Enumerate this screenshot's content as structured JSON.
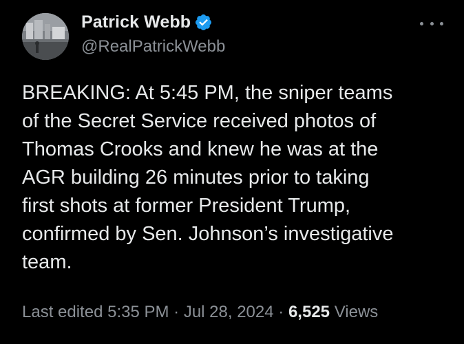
{
  "author": {
    "display_name": "Patrick Webb",
    "handle": "@RealPatrickWebb",
    "verified": true,
    "verified_icon": "verified-badge-icon",
    "verified_color": "#1d9bf0"
  },
  "tweet": {
    "text_lines": [
      "BREAKING: At 5:45 PM, the sniper teams",
      "of the Secret Service received photos of",
      "Thomas Crooks and knew he was at the",
      "AGR building 26 minutes prior to taking",
      "first shots at former President Trump,",
      "confirmed by Sen. Johnson’s investigative",
      "team."
    ],
    "edit_label": "Last edited",
    "time": "5:35 PM",
    "separator": "·",
    "date": "Jul 28, 2024",
    "views_count": "6,525",
    "views_label": "Views"
  },
  "icons": {
    "more": "more-options-icon"
  },
  "colors": {
    "background": "#000000",
    "primary_text": "#e7e9ea",
    "secondary_text": "#8b9096",
    "accent": "#1d9bf0"
  }
}
